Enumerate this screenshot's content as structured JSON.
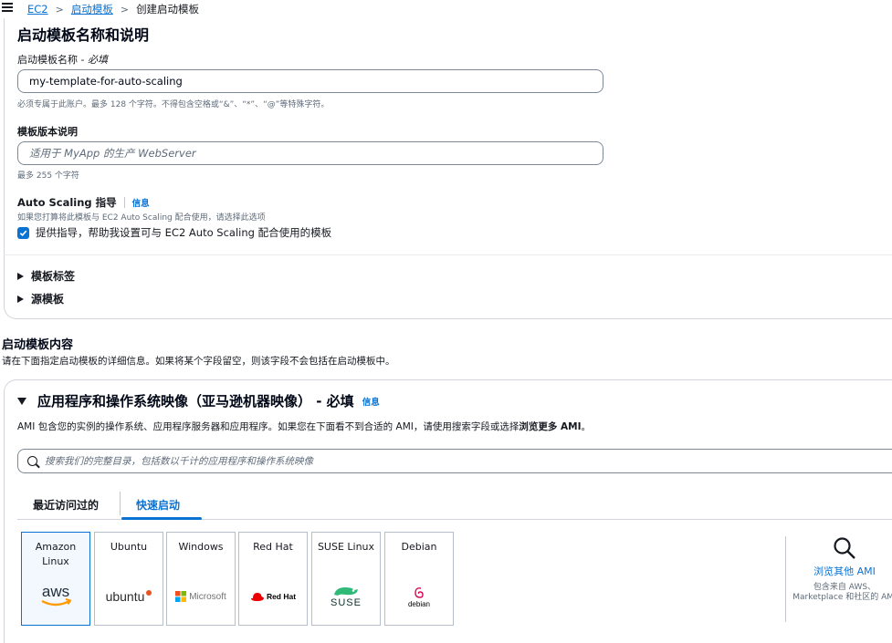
{
  "breadcrumb": {
    "items": [
      "EC2",
      "启动模板"
    ],
    "current": "创建启动模板"
  },
  "template_section": {
    "title": "启动模板名称和说明",
    "name_label": "启动模板名称 - ",
    "name_required": "必填",
    "name_value": "my-template-for-auto-scaling",
    "name_hint": "必须专属于此账户。最多 128 个字符。不得包含空格或“&”、“*”、“@”等特殊字符。",
    "version_label": "模板版本说明",
    "version_placeholder": "适用于 MyApp 的生产 WebServer",
    "version_hint": "最多 255 个字符",
    "auto_scaling_title": "Auto Scaling 指导",
    "info": "信息",
    "auto_scaling_desc": "如果您打算将此模板与 EC2 Auto Scaling 配合使用，请选择此选项",
    "auto_scaling_checkbox": "提供指导，帮助我设置可与 EC2 Auto Scaling 配合使用的模板",
    "expanders": [
      "模板标签",
      "源模板"
    ]
  },
  "content_section": {
    "title": "启动模板内容",
    "desc": "请在下面指定启动模板的详细信息。如果将某个字段留空，则该字段不会包括在启动模板中。"
  },
  "ami_section": {
    "title": "应用程序和操作系统映像（亚马逊机器映像） - 必填",
    "info": "信息",
    "desc_prefix": "AMI 包含您的实例的操作系统、应用程序服务器和应用程序。如果您在下面看不到合适的 AMI，请使用搜索字段或选择",
    "desc_bold": "浏览更多 AMI",
    "desc_suffix": "。",
    "search_placeholder": "搜索我们的完整目录，包括数以千计的应用程序和操作系统映像",
    "tabs": [
      "最近访问过的",
      "快速启动"
    ],
    "os_cards": [
      {
        "name": "Amazon Linux",
        "logo_text": "aws",
        "icon": "aws-logo-icon"
      },
      {
        "name": "Ubuntu",
        "logo_text": "ubuntu",
        "icon": "ubuntu-logo-icon"
      },
      {
        "name": "Windows",
        "logo_text": "Microsoft",
        "icon": "microsoft-logo-icon"
      },
      {
        "name": "Red Hat",
        "logo_text": "Red Hat",
        "icon": "redhat-logo-icon"
      },
      {
        "name": "SUSE Linux",
        "logo_text": "SUSE",
        "icon": "suse-logo-icon"
      },
      {
        "name": "Debian",
        "logo_text": "debian",
        "icon": "debian-logo-icon"
      }
    ],
    "browse_link": "浏览其他 AMI",
    "browse_desc": "包含来自 AWS、Marketplace 和社区的 AMI"
  },
  "colors": {
    "link": "#0972d3",
    "text": "#16191f",
    "muted": "#5f6b7a",
    "aws_orange": "#ff9900",
    "ubuntu_orange": "#e95420",
    "redhat_red": "#ee0000",
    "suse_green": "#30ba78",
    "debian_red": "#d70a53"
  }
}
